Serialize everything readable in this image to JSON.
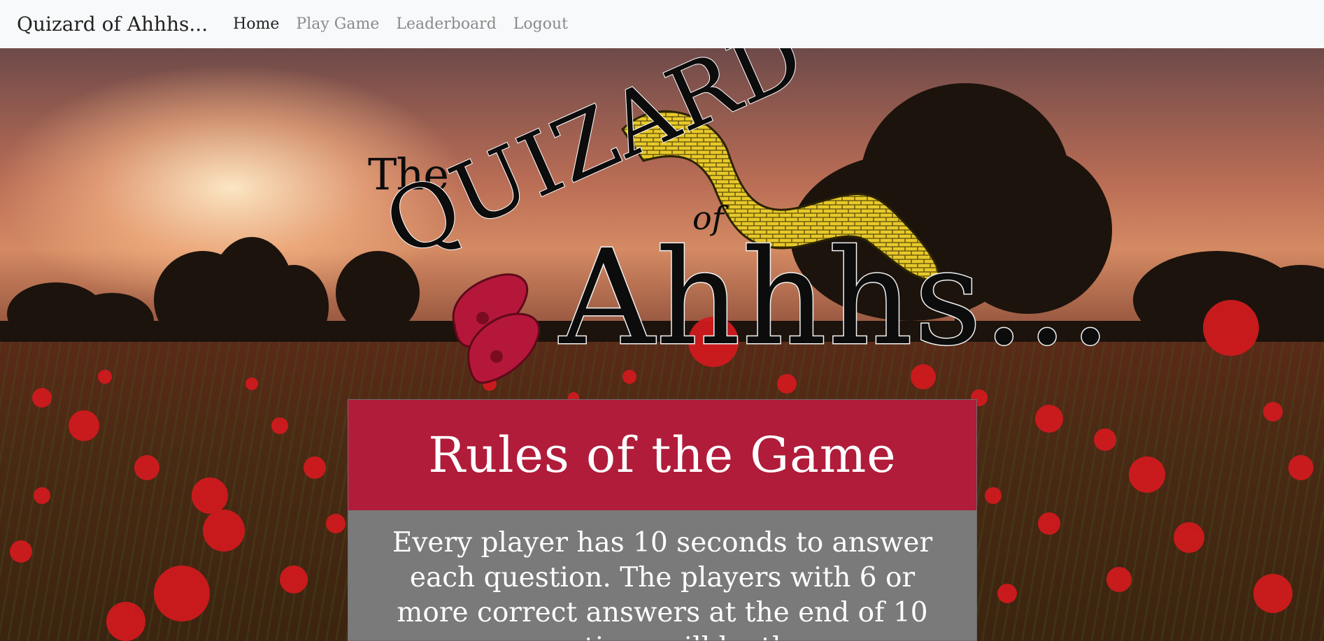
{
  "navbar": {
    "brand": "Quizard of Ahhhs...",
    "links": [
      {
        "label": "Home",
        "active": true
      },
      {
        "label": "Play Game",
        "active": false
      },
      {
        "label": "Leaderboard",
        "active": false
      },
      {
        "label": "Logout",
        "active": false
      }
    ]
  },
  "logo": {
    "the": "The",
    "quizard": "QUIZARD",
    "of": "of",
    "ahhhs": "Ahhhs..."
  },
  "rules_card": {
    "title": "Rules of the Game",
    "body": "Every player has 10 seconds to answer each question. The players with 6 or more correct answers at the end of 10 questions will be the"
  },
  "colors": {
    "card_header": "#b01c3a",
    "card_body": "#7a7a7a",
    "navbar_bg": "#f8f9fa"
  },
  "icons": [
    "yellow-brick-road-icon",
    "ruby-slippers-icon"
  ]
}
